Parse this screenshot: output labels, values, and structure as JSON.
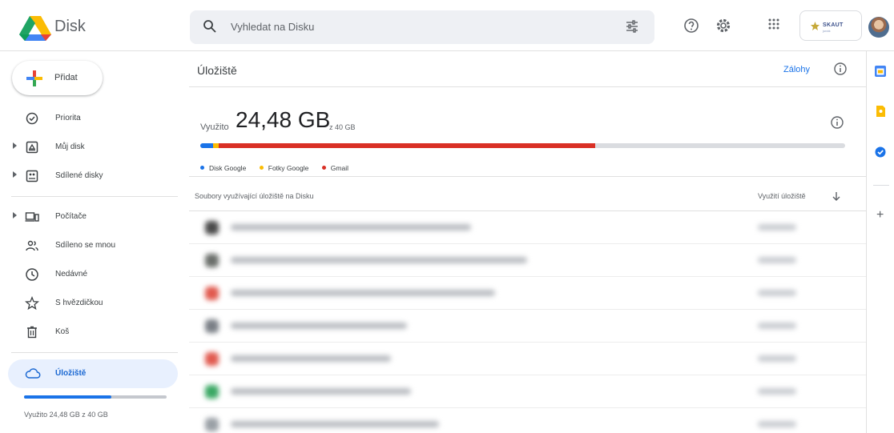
{
  "app": {
    "name": "Disk"
  },
  "search": {
    "placeholder": "Vyhledat na Disku"
  },
  "org_badge": {
    "text": "SKAUT",
    "sub": "junák"
  },
  "sidebar": {
    "new_button": "Přidat",
    "items": [
      {
        "label": "Priorita",
        "icon": "check-circle-icon",
        "has_arrow": false
      },
      {
        "label": "Můj disk",
        "icon": "drive-icon",
        "has_arrow": true
      },
      {
        "label": "Sdílené disky",
        "icon": "shared-drives-icon",
        "has_arrow": true
      },
      {
        "label": "Počítače",
        "icon": "computer-icon",
        "has_arrow": true
      },
      {
        "label": "Sdíleno se mnou",
        "icon": "people-icon",
        "has_arrow": false
      },
      {
        "label": "Nedávné",
        "icon": "clock-icon",
        "has_arrow": false
      },
      {
        "label": "S hvězdičkou",
        "icon": "star-icon",
        "has_arrow": false
      },
      {
        "label": "Koš",
        "icon": "trash-icon",
        "has_arrow": false
      }
    ],
    "active_item": "Úložiště",
    "quota_fraction": 0.612,
    "quota_text": "Využito 24,48 GB z 40 GB"
  },
  "main": {
    "title": "Úložiště",
    "backups_link": "Zálohy",
    "used_prefix": "Využito",
    "used_amount": "24,48 GB",
    "used_of": "z 40 GB",
    "usage_segments": [
      {
        "name": "Disk Google",
        "color": "#1a73e8",
        "fraction": 0.02
      },
      {
        "name": "Fotky Google",
        "color": "#fbbc04",
        "fraction": 0.009
      },
      {
        "name": "Gmail",
        "color": "#d93025",
        "fraction": 0.583
      }
    ],
    "table_header_left": "Soubory využívající úložiště na Disku",
    "table_header_right": "Využití úložiště",
    "rows": [
      {
        "icon_color": "#4a4a4a",
        "name_width": 300
      },
      {
        "icon_color": "#6b6f6b",
        "name_width": 370
      },
      {
        "icon_color": "#e15a4f",
        "name_width": 330
      },
      {
        "icon_color": "#7a7f86",
        "name_width": 220
      },
      {
        "icon_color": "#e15a4f",
        "name_width": 200
      },
      {
        "icon_color": "#3aa864",
        "name_width": 225
      },
      {
        "icon_color": "#9aa0a6",
        "name_width": 260
      }
    ]
  },
  "colors": {
    "accent": "#1a73e8",
    "active_bg": "#e8f0fe"
  }
}
